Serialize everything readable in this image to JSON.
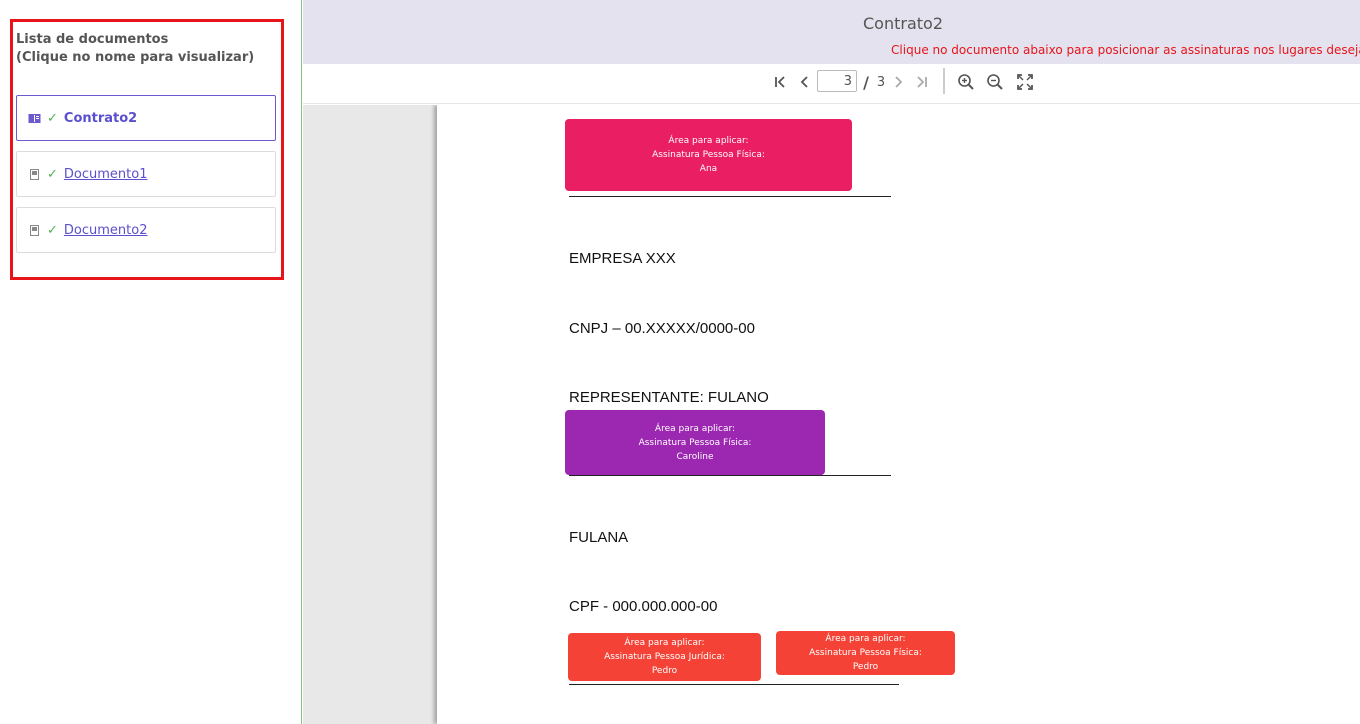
{
  "sidebar": {
    "title_line1": "Lista de documentos",
    "title_line2": "(Clique no nome para visualizar)",
    "documents": [
      {
        "label": "Contrato2",
        "status": "check-icon"
      },
      {
        "label": "Documento1",
        "status": "check-icon"
      },
      {
        "label": "Documento2",
        "status": "check-icon"
      }
    ]
  },
  "header": {
    "title": "Contrato2",
    "instruction": "Clique no documento abaixo para posicionar as assinaturas nos lugares desejados"
  },
  "toolbar": {
    "current_page": "3",
    "separator": "/",
    "total_pages": "3",
    "icons": [
      "first-page-icon",
      "previous-page-icon",
      "next-page-icon",
      "last-page-icon",
      "zoom-in-icon",
      "zoom-out-icon",
      "fullscreen-icon"
    ]
  },
  "page": {
    "lines": [
      "EMPRESA XXX",
      "CNPJ – 00.XXXXX/0000-00",
      "REPRESENTANTE: FULANO",
      "FULANA",
      "CPF - 000.000.000-00"
    ],
    "signature_areas": [
      {
        "line1": "Área para aplicar:",
        "line2": "Assinatura Pessoa Física:",
        "line3": "Ana",
        "color": "#e91e63"
      },
      {
        "line1": "Área para aplicar:",
        "line2": "Assinatura Pessoa Física:",
        "line3": "Caroline",
        "color": "#9c27b0"
      },
      {
        "line1": "Área para aplicar:",
        "line2": "Assinatura Pessoa Jurídica:",
        "line3": "Pedro",
        "color": "#f44336"
      },
      {
        "line1": "Área para aplicar:",
        "line2": "Assinatura Pessoa Física:",
        "line3": "Pedro",
        "color": "#f44336"
      }
    ]
  },
  "colors": {
    "accent": "#5a4fcf",
    "panel_border": "#e8141a",
    "check": "#4caf50",
    "header_bg": "#e4e2ee"
  }
}
